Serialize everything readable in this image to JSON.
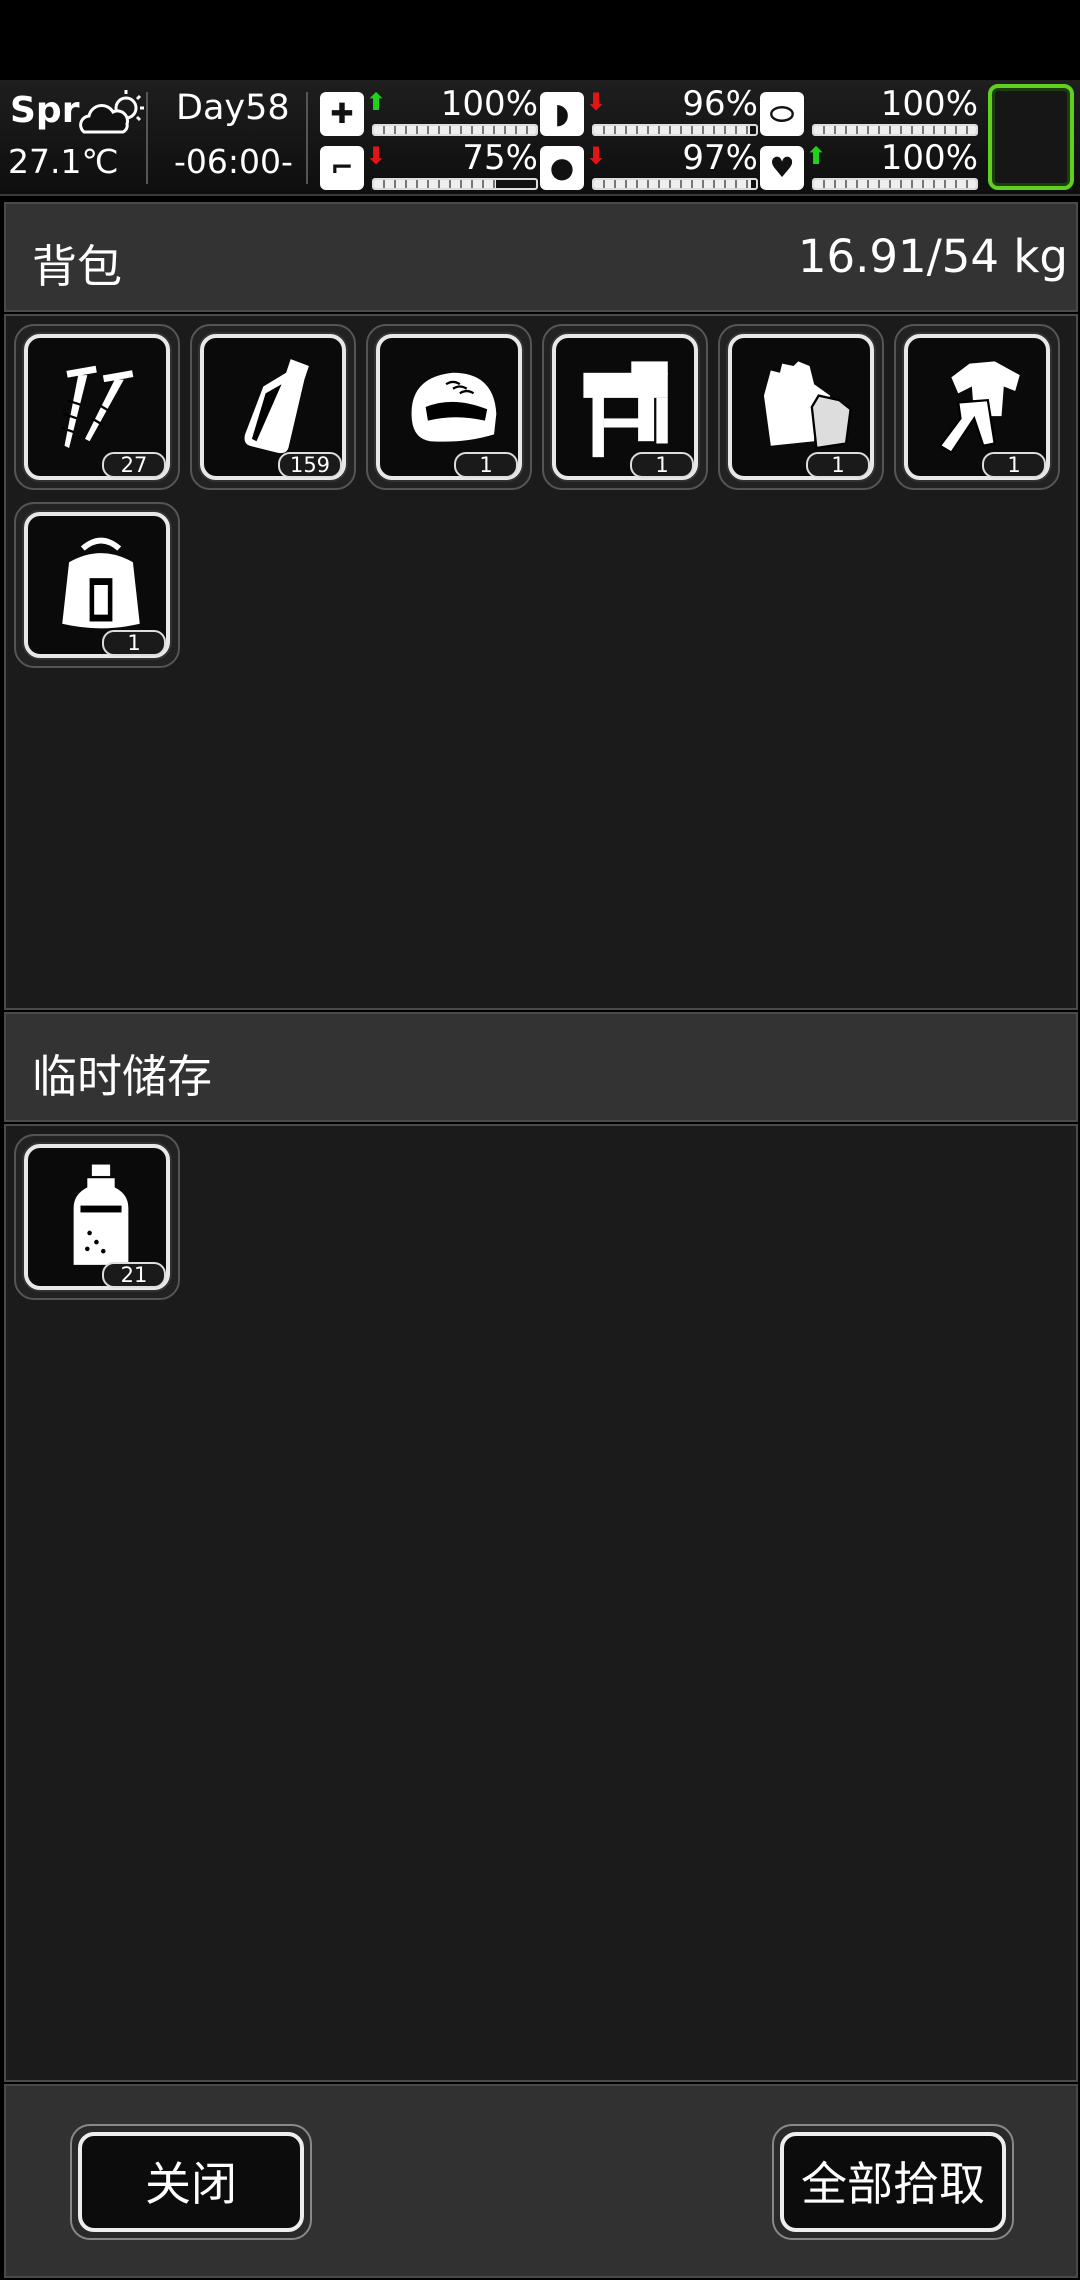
{
  "hud": {
    "season": "Spr",
    "weather_icon": "partly-cloudy-sun-icon",
    "temperature": "27.1℃",
    "day": "Day58",
    "time": "-06:00-",
    "stats": [
      {
        "name": "health",
        "icon": "first-aid-kit-icon",
        "trend": "up",
        "value": "100%",
        "level": 1.0
      },
      {
        "name": "hunger",
        "icon": "stomach-icon",
        "trend": "down",
        "value": "96%",
        "level": 0.96
      },
      {
        "name": "energy",
        "icon": "pill-icon",
        "trend": "none",
        "value": "100%",
        "level": 1.0
      },
      {
        "name": "stamina",
        "icon": "foot-icon",
        "trend": "down",
        "value": "75%",
        "level": 0.75
      },
      {
        "name": "thirst",
        "icon": "water-drop-icon",
        "trend": "down",
        "value": "97%",
        "level": 0.97
      },
      {
        "name": "mood",
        "icon": "heart-icon",
        "trend": "up",
        "value": "100%",
        "level": 1.0
      }
    ]
  },
  "backpack": {
    "title": "背包",
    "weight": "16.91/54 kg",
    "items": [
      {
        "icon": "screws-icon",
        "count": "27"
      },
      {
        "icon": "bottle-icon",
        "count": "159"
      },
      {
        "icon": "helmet-icon",
        "count": "1"
      },
      {
        "icon": "nail-gun-icon",
        "count": "1"
      },
      {
        "icon": "gloves-icon",
        "count": "1"
      },
      {
        "icon": "clothing-set-icon",
        "count": "1"
      },
      {
        "icon": "backpack-icon",
        "count": "1"
      }
    ]
  },
  "temp_storage": {
    "title": "临时储存",
    "items": [
      {
        "icon": "liquid-bottle-icon",
        "count": "21"
      }
    ]
  },
  "buttons": {
    "close": "关闭",
    "pickup_all": "全部拾取"
  },
  "colors": {
    "accent_green": "#60d020",
    "up": "#22d11e",
    "down": "#e01515"
  }
}
